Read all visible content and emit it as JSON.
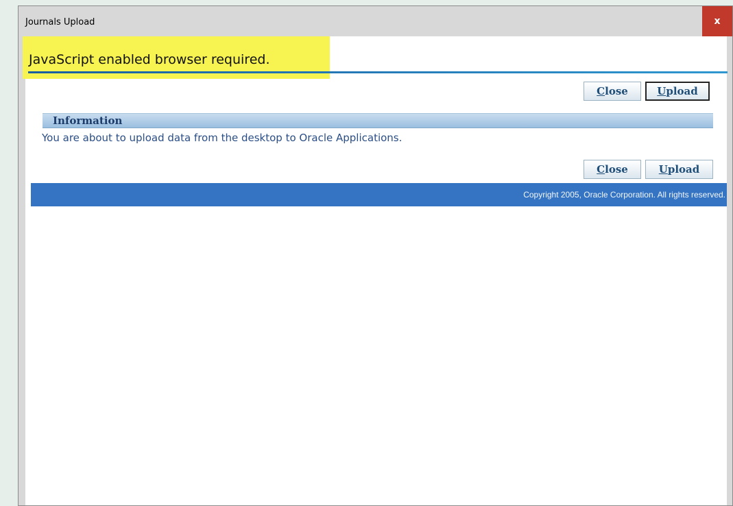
{
  "window": {
    "title": "Journals Upload",
    "close_glyph": "x"
  },
  "content": {
    "js_message": "JavaScript enabled browser required.",
    "buttons_top": {
      "close_prefix": "C",
      "close_rest": "lose",
      "upload_prefix": "U",
      "upload_rest": "pload"
    },
    "info": {
      "header": "Information",
      "message": "You are about to upload data from the desktop to Oracle Applications."
    },
    "buttons_bottom": {
      "close_prefix": "C",
      "close_rest": "lose",
      "upload_prefix": "U",
      "upload_rest": "pload"
    },
    "footer": {
      "copyright": "Copyright 2005, Oracle Corporation. All rights reserved."
    }
  },
  "colors": {
    "highlight": "#f7f350",
    "close_button_bg": "#c0392b",
    "footer_bg": "#3474c3",
    "info_text": "#2b4e86"
  }
}
